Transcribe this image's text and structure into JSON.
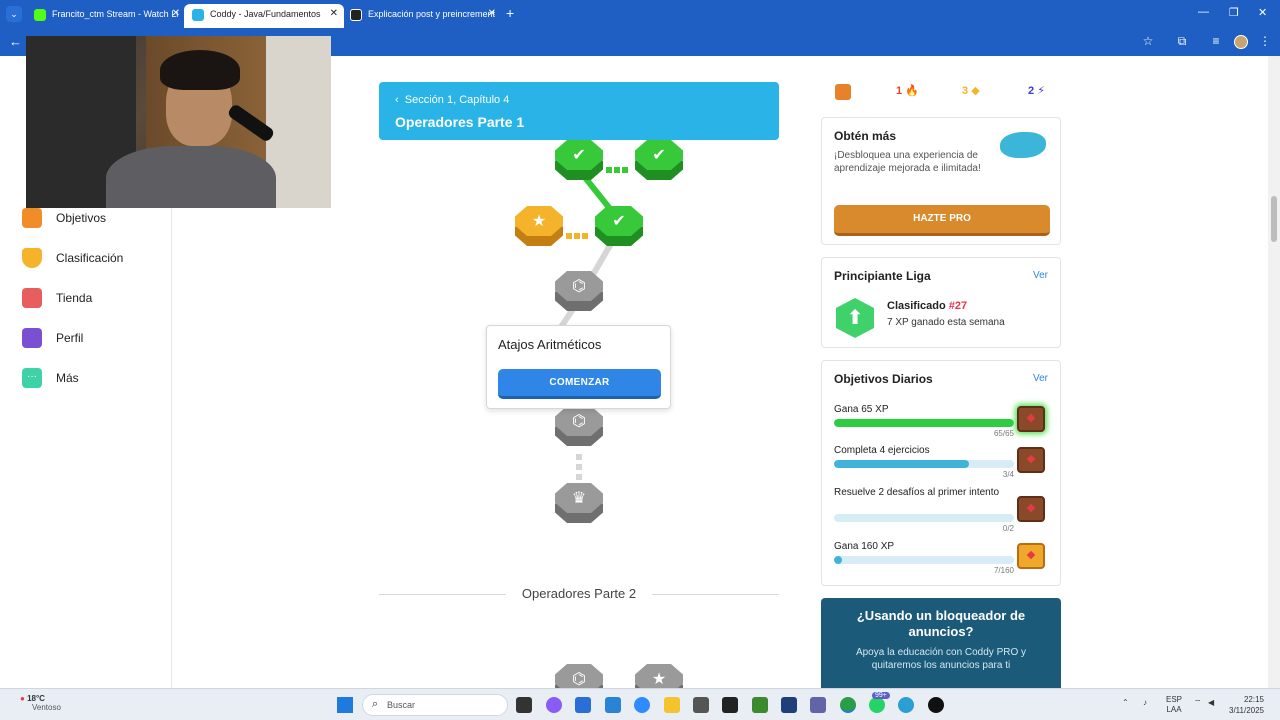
{
  "browser": {
    "tabs": [
      {
        "label": "Francito_ctm Stream - Watch Li",
        "active": false,
        "favicon_color": "#53fc18"
      },
      {
        "label": "Coddy - Java/Fundamentos",
        "active": true,
        "favicon_color": "#29b3e6"
      },
      {
        "label": "Explicación post y preincrement",
        "active": false,
        "favicon_color": "#222222"
      }
    ],
    "new_tab": "+",
    "close": "✕"
  },
  "sidebar": {
    "items": [
      {
        "label": "Objetivos",
        "icon": "flag-icon",
        "color": "#f28c28"
      },
      {
        "label": "Clasificación",
        "icon": "trophy-icon",
        "color": "#f4b32a"
      },
      {
        "label": "Tienda",
        "icon": "shop-icon",
        "color": "#e85d5d"
      },
      {
        "label": "Perfil",
        "icon": "profile-icon",
        "color": "#7a4fd1"
      },
      {
        "label": "Más",
        "icon": "more-icon",
        "color": "#3fd2a8"
      }
    ]
  },
  "section": {
    "breadcrumb": "Sección 1, Capítulo 4",
    "title": "Operadores Parte 1",
    "color": "#29b3e6"
  },
  "popup": {
    "title": "Atajos Aritméticos",
    "button": "COMENZAR"
  },
  "next_section": "Operadores Parte 2",
  "stats": {
    "streak": "1",
    "gems": "3",
    "energy": "2"
  },
  "pro_card": {
    "title": "Obtén más",
    "description": "¡Desbloquea una experiencia de aprendizaje mejorada e ilimitada!",
    "button": "HAZTE PRO"
  },
  "league_card": {
    "title": "Principiante Liga",
    "link": "Ver",
    "rank_label": "Clasificado",
    "rank": "#27",
    "xp": "7 XP ganado esta semana"
  },
  "goals_card": {
    "title": "Objetivos Diarios",
    "link": "Ver",
    "goals": [
      {
        "label": "Gana 65 XP",
        "count": "65/65",
        "progress": 1.0,
        "color": "#2ecc40"
      },
      {
        "label": "Completa 4 ejercicios",
        "count": "3/4",
        "progress": 0.75,
        "color": "#3fb3d9"
      },
      {
        "label": "Resuelve 2 desafíos al primer intento",
        "count": "0/2",
        "progress": 0.0,
        "color": "#3fb3d9"
      },
      {
        "label": "Gana 160 XP",
        "count": "7/160",
        "progress": 0.044,
        "color": "#3fb3d9"
      }
    ]
  },
  "ad_card": {
    "title": "¿Usando un bloqueador de anuncios?",
    "description": "Apoya la educación con Coddy PRO y quitaremos los anuncios para ti"
  },
  "taskbar": {
    "temperature": "18°C",
    "weather": "Ventoso",
    "search_placeholder": "Buscar",
    "language": "ESP",
    "region": "LAA",
    "time": "22:15",
    "date": "3/11/2025",
    "notification_count": "99+"
  }
}
